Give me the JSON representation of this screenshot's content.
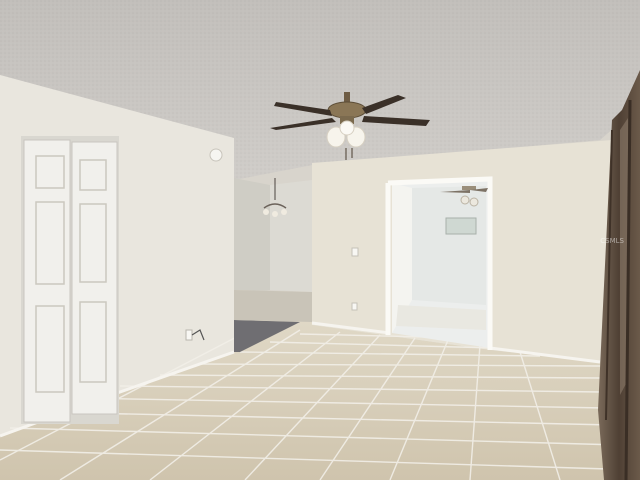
{
  "scene": {
    "description_visible_text": "",
    "watermark": "CSMLS",
    "colors": {
      "ceiling": "#cfcdca",
      "wall_left": "#e9e6de",
      "wall_back": "#e7e2d5",
      "floor_tile": "#d9cfba",
      "grout": "#f2efe8",
      "door": "#f1f0ec",
      "fan_blade": "#3a3028",
      "fan_brass": "#8a7656",
      "curtain": "#5a4a3c",
      "rug": "#6f6e72"
    },
    "objects": [
      "ceiling-fan",
      "ceiling-light",
      "chandelier",
      "bifold-closet-door",
      "doorway",
      "window-curtain",
      "tile-floor",
      "area-rug",
      "smoke-detector",
      "wall-outlet"
    ]
  }
}
